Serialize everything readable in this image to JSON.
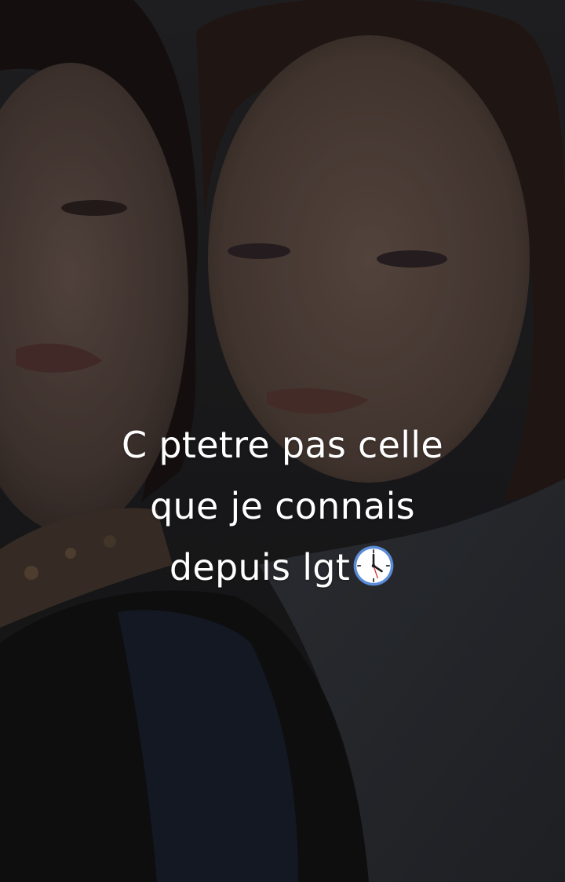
{
  "story": {
    "caption_lines": [
      "C ptetre pas celle",
      "que je connais",
      "depuis lgt"
    ],
    "trailing_emoji": "clock-icon"
  },
  "colors": {
    "caption_text": "#ffffff",
    "overlay": "#000000"
  }
}
